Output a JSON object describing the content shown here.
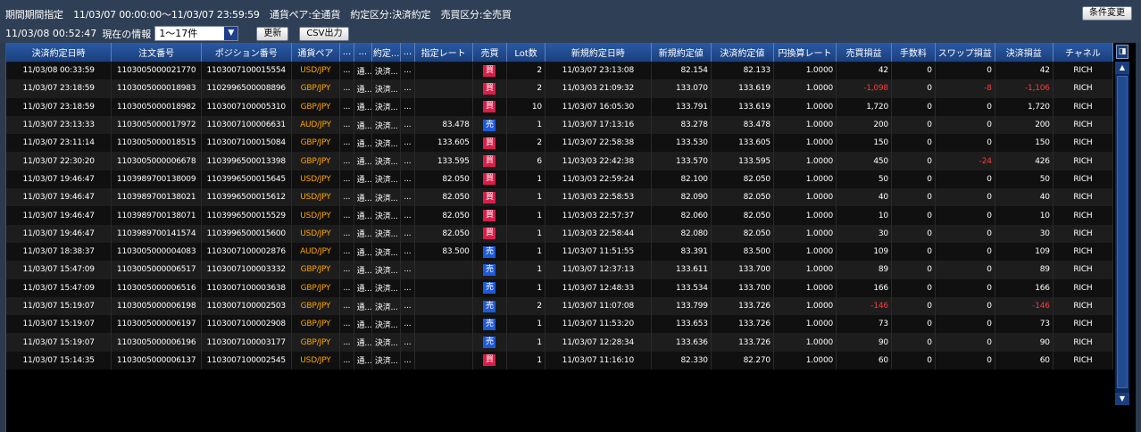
{
  "header": {
    "filter_items": [
      "期間期間指定",
      "11/03/07 00:00:00～11/03/07 23:59:59",
      "通貨ペア:全通貨",
      "約定区分:決済約定",
      "売買区分:全売買"
    ],
    "timestamp": "11/03/08 00:52:47",
    "current_info_label": "現在の情報",
    "range_select_value": "1～17件",
    "update_button": "更新",
    "csv_button": "CSV出力",
    "change_conditions_button": "条件変更"
  },
  "table": {
    "columns": [
      "決済約定日時",
      "注文番号",
      "ポジション番号",
      "通貨ペア",
      "...",
      "...",
      "約定...",
      "...",
      "指定レート",
      "売買",
      "Lot数",
      "新規約定日時",
      "新規約定値",
      "決済約定値",
      "円換算レート",
      "売買損益",
      "手数料",
      "スワップ損益",
      "決済損益",
      "チャネル"
    ],
    "rows": [
      [
        "11/03/08 00:33:59",
        "1103005000021770",
        "1103007100015554",
        "USD/JPY",
        "...",
        "通...",
        "決済...",
        "...",
        "",
        "買",
        "2",
        "11/03/07 23:13:08",
        "82.154",
        "82.133",
        "1.0000",
        "42",
        "0",
        "0",
        "42",
        "RICH"
      ],
      [
        "11/03/07 23:18:59",
        "1103005000018983",
        "1102996500008896",
        "GBP/JPY",
        "...",
        "通...",
        "決済...",
        "...",
        "",
        "買",
        "2",
        "11/03/03 21:09:32",
        "133.070",
        "133.619",
        "1.0000",
        "-1,098",
        "0",
        "-8",
        "-1,106",
        "RICH"
      ],
      [
        "11/03/07 23:18:59",
        "1103005000018982",
        "1103007100005310",
        "GBP/JPY",
        "...",
        "通...",
        "決済...",
        "...",
        "",
        "買",
        "10",
        "11/03/07 16:05:30",
        "133.791",
        "133.619",
        "1.0000",
        "1,720",
        "0",
        "0",
        "1,720",
        "RICH"
      ],
      [
        "11/03/07 23:13:33",
        "1103005000017972",
        "1103007100006631",
        "AUD/JPY",
        "...",
        "通...",
        "決済...",
        "...",
        "83.478",
        "売",
        "1",
        "11/03/07 17:13:16",
        "83.278",
        "83.478",
        "1.0000",
        "200",
        "0",
        "0",
        "200",
        "RICH"
      ],
      [
        "11/03/07 23:11:14",
        "1103005000018515",
        "1103007100015084",
        "GBP/JPY",
        "...",
        "通...",
        "決済...",
        "...",
        "133.605",
        "買",
        "2",
        "11/03/07 22:58:38",
        "133.530",
        "133.605",
        "1.0000",
        "150",
        "0",
        "0",
        "150",
        "RICH"
      ],
      [
        "11/03/07 22:30:20",
        "1103005000006678",
        "1103996500013398",
        "GBP/JPY",
        "...",
        "通...",
        "決済...",
        "...",
        "133.595",
        "買",
        "6",
        "11/03/03 22:42:38",
        "133.570",
        "133.595",
        "1.0000",
        "450",
        "0",
        "-24",
        "426",
        "RICH"
      ],
      [
        "11/03/07 19:46:47",
        "1103989700138009",
        "1103996500015645",
        "USD/JPY",
        "...",
        "通...",
        "決済...",
        "...",
        "82.050",
        "買",
        "1",
        "11/03/03 22:59:24",
        "82.100",
        "82.050",
        "1.0000",
        "50",
        "0",
        "0",
        "50",
        "RICH"
      ],
      [
        "11/03/07 19:46:47",
        "1103989700138021",
        "1103996500015612",
        "USD/JPY",
        "...",
        "通...",
        "決済...",
        "...",
        "82.050",
        "買",
        "1",
        "11/03/03 22:58:53",
        "82.090",
        "82.050",
        "1.0000",
        "40",
        "0",
        "0",
        "40",
        "RICH"
      ],
      [
        "11/03/07 19:46:47",
        "1103989700138071",
        "1103996500015529",
        "USD/JPY",
        "...",
        "通...",
        "決済...",
        "...",
        "82.050",
        "買",
        "1",
        "11/03/03 22:57:37",
        "82.060",
        "82.050",
        "1.0000",
        "10",
        "0",
        "0",
        "10",
        "RICH"
      ],
      [
        "11/03/07 19:46:47",
        "1103989700141574",
        "1103996500015600",
        "USD/JPY",
        "...",
        "通...",
        "決済...",
        "...",
        "82.050",
        "買",
        "1",
        "11/03/03 22:58:44",
        "82.080",
        "82.050",
        "1.0000",
        "30",
        "0",
        "0",
        "30",
        "RICH"
      ],
      [
        "11/03/07 18:38:37",
        "1103005000004083",
        "1103007100002876",
        "AUD/JPY",
        "...",
        "通...",
        "決済...",
        "...",
        "83.500",
        "売",
        "1",
        "11/03/07 11:51:55",
        "83.391",
        "83.500",
        "1.0000",
        "109",
        "0",
        "0",
        "109",
        "RICH"
      ],
      [
        "11/03/07 15:47:09",
        "1103005000006517",
        "1103007100003332",
        "GBP/JPY",
        "...",
        "通...",
        "決済...",
        "...",
        "",
        "売",
        "1",
        "11/03/07 12:37:13",
        "133.611",
        "133.700",
        "1.0000",
        "89",
        "0",
        "0",
        "89",
        "RICH"
      ],
      [
        "11/03/07 15:47:09",
        "1103005000006516",
        "1103007100003638",
        "GBP/JPY",
        "...",
        "通...",
        "決済...",
        "...",
        "",
        "売",
        "1",
        "11/03/07 12:48:33",
        "133.534",
        "133.700",
        "1.0000",
        "166",
        "0",
        "0",
        "166",
        "RICH"
      ],
      [
        "11/03/07 15:19:07",
        "1103005000006198",
        "1103007100002503",
        "GBP/JPY",
        "...",
        "通...",
        "決済...",
        "...",
        "",
        "売",
        "2",
        "11/03/07 11:07:08",
        "133.799",
        "133.726",
        "1.0000",
        "-146",
        "0",
        "0",
        "-146",
        "RICH"
      ],
      [
        "11/03/07 15:19:07",
        "1103005000006197",
        "1103007100002908",
        "GBP/JPY",
        "...",
        "通...",
        "決済...",
        "...",
        "",
        "売",
        "1",
        "11/03/07 11:53:20",
        "133.653",
        "133.726",
        "1.0000",
        "73",
        "0",
        "0",
        "73",
        "RICH"
      ],
      [
        "11/03/07 15:19:07",
        "1103005000006196",
        "1103007100003177",
        "GBP/JPY",
        "...",
        "通...",
        "決済...",
        "...",
        "",
        "売",
        "1",
        "11/03/07 12:28:34",
        "133.636",
        "133.726",
        "1.0000",
        "90",
        "0",
        "0",
        "90",
        "RICH"
      ],
      [
        "11/03/07 15:14:35",
        "1103005000006137",
        "1103007100002545",
        "USD/JPY",
        "...",
        "通...",
        "決済...",
        "...",
        "",
        "買",
        "1",
        "11/03/07 11:16:10",
        "82.330",
        "82.270",
        "1.0000",
        "60",
        "0",
        "0",
        "60",
        "RICH"
      ]
    ]
  },
  "colors": {
    "buy": "#d81f4a",
    "sell": "#1f5ad8",
    "pair": "#ffa500",
    "negative": "#ff3a3a"
  },
  "icons": {
    "dropdown": "triangle-down-icon",
    "corner": "column-settings-icon",
    "scroll_up": "arrow-up-icon",
    "scroll_down": "arrow-down-icon"
  }
}
